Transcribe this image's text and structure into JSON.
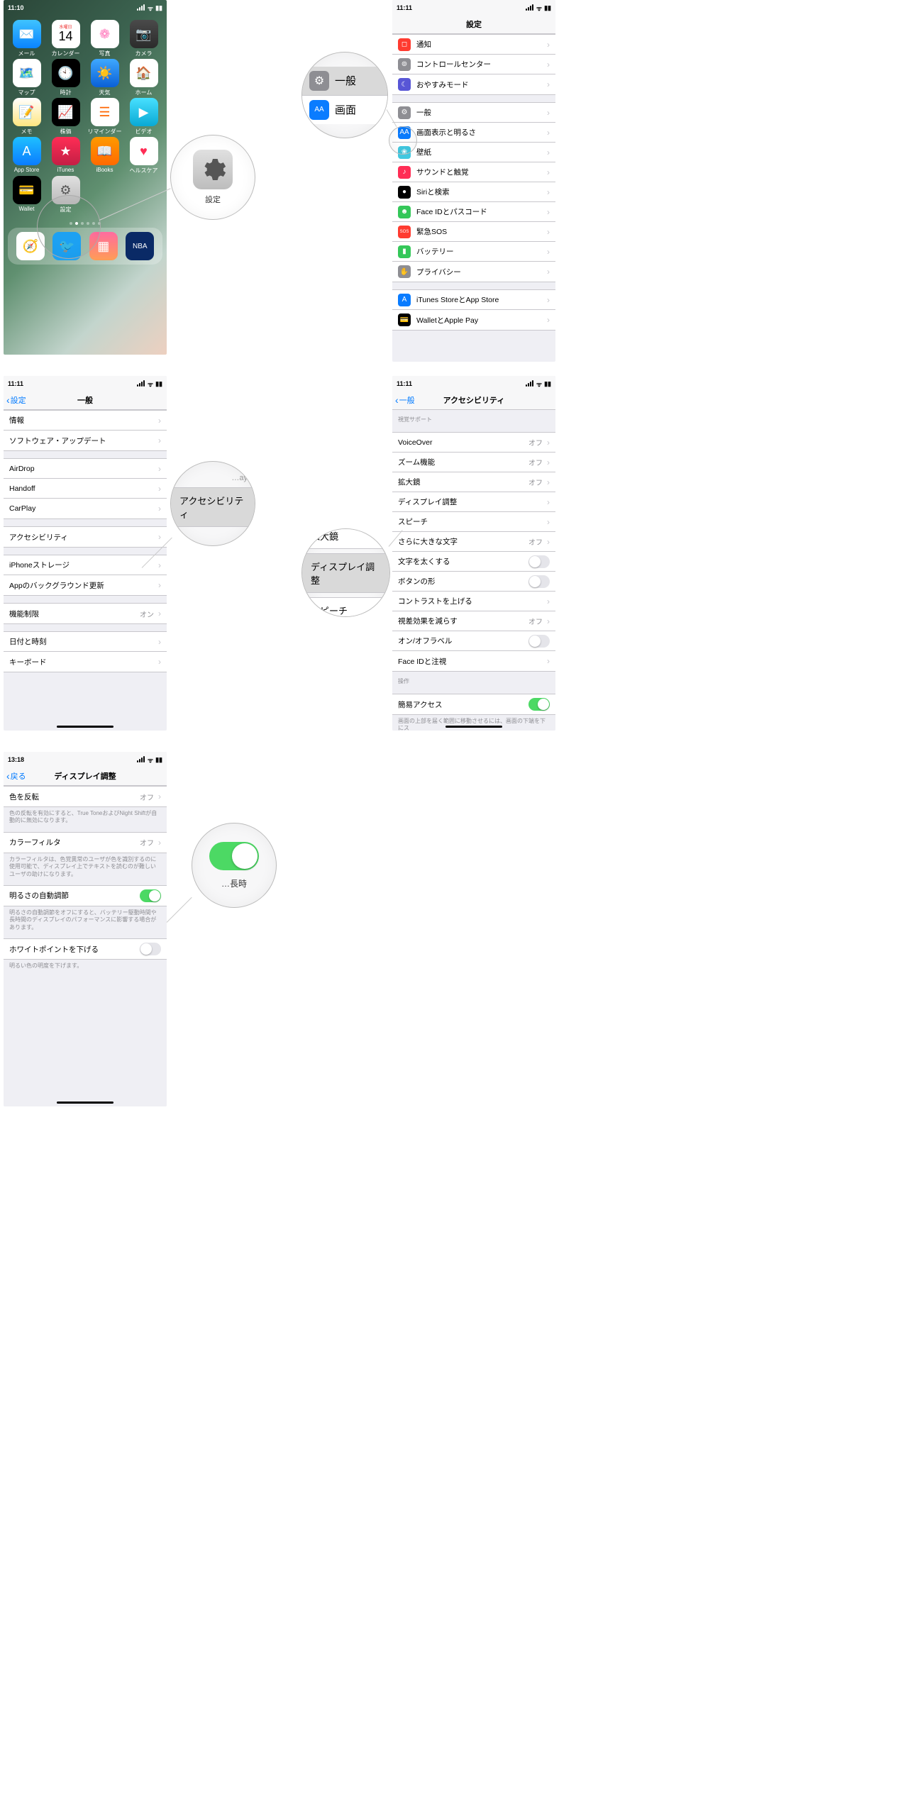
{
  "status": {
    "t1": "11:10",
    "t2": "11:11",
    "t3": "13:18",
    "loc": "⟟"
  },
  "home": {
    "apps": [
      {
        "l": "メール",
        "c": "linear-gradient(#3fc3ff,#0a84ff)",
        "g": "✉️"
      },
      {
        "l": "カレンダー",
        "c": "#fff",
        "g": "14",
        "sub": "水曜日",
        "tc": "#e33"
      },
      {
        "l": "写真",
        "c": "#fff",
        "g": "❁",
        "tc": "#f7b"
      },
      {
        "l": "カメラ",
        "c": "linear-gradient(#4a4a4a,#2b2b2b)",
        "g": "📷"
      },
      {
        "l": "マップ",
        "c": "#fff",
        "g": "🗺️"
      },
      {
        "l": "時計",
        "c": "#000",
        "g": "🕙"
      },
      {
        "l": "天気",
        "c": "linear-gradient(#3fa8ff,#0a60d6)",
        "g": "☀️"
      },
      {
        "l": "ホーム",
        "c": "#fff",
        "g": "🏠",
        "tc": "#f90"
      },
      {
        "l": "メモ",
        "c": "linear-gradient(#fff,#ffe680)",
        "g": "📝"
      },
      {
        "l": "株価",
        "c": "#000",
        "g": "📈"
      },
      {
        "l": "リマインダー",
        "c": "#fff",
        "g": "☰",
        "tc": "#f60"
      },
      {
        "l": "ビデオ",
        "c": "linear-gradient(#48e0ff,#09a9d4)",
        "g": "▶︎"
      },
      {
        "l": "App Store",
        "c": "linear-gradient(#1fc0ff,#0a7cff)",
        "g": "A"
      },
      {
        "l": "iTunes",
        "c": "linear-gradient(#ff2d55,#c41f45)",
        "g": "★"
      },
      {
        "l": "iBooks",
        "c": "linear-gradient(#ff9a00,#ff6a00)",
        "g": "📖"
      },
      {
        "l": "ヘルスケア",
        "c": "#fff",
        "g": "♥",
        "tc": "#ff2d55"
      },
      {
        "l": "Wallet",
        "c": "#000",
        "g": "💳"
      },
      {
        "l": "設定",
        "c": "linear-gradient(#e0e0e0,#bababa)",
        "g": "⚙︎",
        "tc": "#555"
      }
    ],
    "dock": [
      {
        "c": "#fff",
        "g": "🧭"
      },
      {
        "c": "#1da1f2",
        "g": "🐦"
      },
      {
        "c": "linear-gradient(#ff6ba0,#ff9d55)",
        "g": "▦"
      },
      {
        "c": "#0a2a66",
        "g": "NBA",
        "tc": "#fff",
        "fs": "10px"
      }
    ]
  },
  "callout_settings_label": "設定",
  "callout_general_label": "一般",
  "callout_screen_label": "画面",
  "settings_title": "設定",
  "settings_rows": [
    {
      "l": "通知",
      "c": "#ff3b30",
      "g": "◻︎"
    },
    {
      "l": "コントロールセンター",
      "c": "#8e8e93",
      "g": "⊚"
    },
    {
      "l": "おやすみモード",
      "c": "#5856d6",
      "g": "☾"
    }
  ],
  "settings_rows2": [
    {
      "l": "一般",
      "c": "#8e8e93",
      "g": "⚙︎"
    },
    {
      "l": "画面表示と明るさ",
      "c": "#0a7cff",
      "g": "AA"
    },
    {
      "l": "壁紙",
      "c": "#41c8e0",
      "g": "❀"
    },
    {
      "l": "サウンドと触覚",
      "c": "#ff2d55",
      "g": "♪"
    },
    {
      "l": "Siriと検索",
      "c": "#000",
      "g": "●"
    },
    {
      "l": "Face IDとパスコード",
      "c": "#34c759",
      "g": "☻"
    },
    {
      "l": "緊急SOS",
      "c": "#ff3b30",
      "g": "SOS",
      "fs": "6px"
    },
    {
      "l": "バッテリー",
      "c": "#34c759",
      "g": "▮"
    },
    {
      "l": "プライバシー",
      "c": "#8e8e93",
      "g": "✋"
    }
  ],
  "settings_rows3": [
    {
      "l": "iTunes StoreとApp Store",
      "c": "#0a7cff",
      "g": "A"
    },
    {
      "l": "WalletとApple Pay",
      "c": "#000",
      "g": "💳"
    }
  ],
  "general": {
    "back": "設定",
    "title": "一般",
    "g1": [
      "情報",
      "ソフトウェア・アップデート"
    ],
    "g2": [
      "AirDrop",
      "Handoff",
      "CarPlay"
    ],
    "g3": [
      "アクセシビリティ"
    ],
    "g4": [
      "iPhoneストレージ",
      "Appのバックグラウンド更新"
    ],
    "g5": [
      {
        "l": "機能制限",
        "v": "オン"
      }
    ],
    "g6": [
      "日付と時刻",
      "キーボード"
    ]
  },
  "callout_access": "アクセシビリティ",
  "callout_access_above": "…ay",
  "access": {
    "back": "一般",
    "title": "アクセシビリティ",
    "sec1": "視覚サポート",
    "sec2": "操作",
    "rows": [
      {
        "l": "VoiceOver",
        "v": "オフ",
        "chev": true
      },
      {
        "l": "ズーム機能",
        "v": "オフ",
        "chev": true
      },
      {
        "l": "拡大鏡",
        "v": "オフ",
        "chev": true
      },
      {
        "l": "ディスプレイ調整",
        "chev": true
      },
      {
        "l": "スピーチ",
        "chev": true
      },
      {
        "l": "さらに大きな文字",
        "v": "オフ",
        "chev": true
      },
      {
        "l": "文字を太くする",
        "toggle": false
      },
      {
        "l": "ボタンの形",
        "toggle": false
      },
      {
        "l": "コントラストを上げる",
        "chev": true
      },
      {
        "l": "視差効果を減らす",
        "v": "オフ",
        "chev": true
      },
      {
        "l": "オン/オフラベル",
        "toggle": false
      },
      {
        "l": "Face IDと注視",
        "chev": true
      }
    ],
    "easy": {
      "l": "簡易アクセス",
      "toggle": true
    },
    "easy_note": "画面の上部を届く範囲に移動させるには、画面の下端を下にス"
  },
  "callout_disp": [
    "拡大鏡",
    "ディスプレイ調整",
    "スピーチ"
  ],
  "disp": {
    "back": "戻る",
    "title": "ディスプレイ調整",
    "r1": {
      "l": "色を反転",
      "v": "オフ"
    },
    "n1": "色の反転を有効にすると、True ToneおよびNight Shiftが自動的に無効になります。",
    "r2": {
      "l": "カラーフィルタ",
      "v": "オフ"
    },
    "n2": "カラーフィルタは、色覚異常のユーザが色を識別するのに使用可能で、ディスプレイ上でテキストを読むのが難しいユーザの助けになります。",
    "r3": {
      "l": "明るさの自動調節"
    },
    "n3": "明るさの自動調節をオフにすると、バッテリー駆動時間や長時間のディスプレイのパフォーマンスに影響する場合があります。",
    "r4": {
      "l": "ホワイトポイントを下げる"
    },
    "n4": "明るい色の明度を下げます。"
  },
  "callout_toggle_caption": "…長時"
}
